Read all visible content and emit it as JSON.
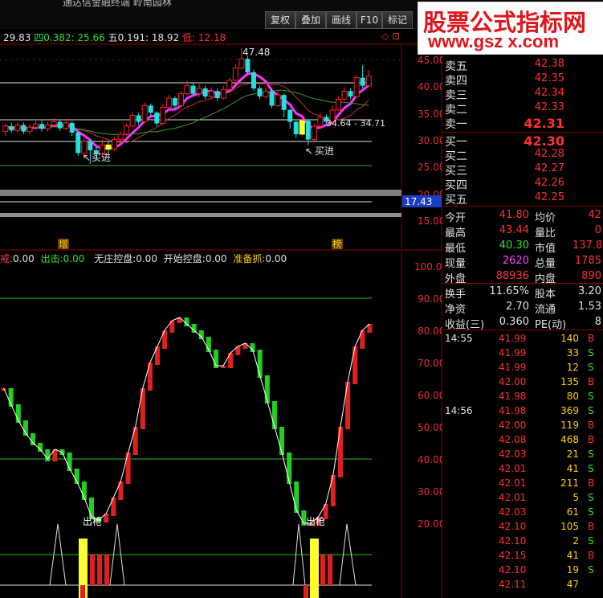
{
  "window": {
    "title": "通达信金融终端   岭南园林"
  },
  "toolbar": {
    "buttons": [
      "复权",
      "叠加",
      "画线",
      "F10",
      "标记"
    ]
  },
  "watermark": {
    "title": "股票公式指标网",
    "url": "www.gsz x.com"
  },
  "price_chart": {
    "ma_line": {
      "v1": "29.83",
      "v2_label": "四0.382:",
      "v2": "25.66",
      "v3_label": "五0.191:",
      "v3": "18.92",
      "low_label": "低:",
      "low": "12.18"
    },
    "annotations": {
      "high": "47.48",
      "range": "34.64 - 34.71",
      "buy1": "买进",
      "buy2": "买进",
      "arrow": "↖"
    },
    "y_axis": [
      "45.00",
      "40.00",
      "35.00",
      "30.00",
      "25.00",
      "20.00",
      "15.00"
    ],
    "current_tag": "17.43",
    "candles": [
      {
        "o": 32.0,
        "c": 33.0,
        "h": 33.5,
        "l": 31.2
      },
      {
        "o": 33.0,
        "c": 32.2,
        "h": 33.6,
        "l": 31.8
      },
      {
        "o": 32.2,
        "c": 33.2,
        "h": 33.8,
        "l": 31.9
      },
      {
        "o": 33.2,
        "c": 32.0,
        "h": 33.7,
        "l": 31.5
      },
      {
        "o": 32.0,
        "c": 32.8,
        "h": 33.4,
        "l": 31.6
      },
      {
        "o": 32.8,
        "c": 33.4,
        "h": 34.0,
        "l": 32.4
      },
      {
        "o": 33.4,
        "c": 32.5,
        "h": 34.0,
        "l": 32.0
      },
      {
        "o": 32.5,
        "c": 33.2,
        "h": 33.8,
        "l": 32.0
      },
      {
        "o": 33.2,
        "c": 33.8,
        "h": 34.5,
        "l": 32.8
      },
      {
        "o": 33.8,
        "c": 32.6,
        "h": 34.2,
        "l": 32.1
      },
      {
        "o": 32.6,
        "c": 33.6,
        "h": 34.2,
        "l": 32.2
      },
      {
        "o": 33.6,
        "c": 31.8,
        "h": 33.9,
        "l": 31.2
      },
      {
        "o": 31.8,
        "c": 28.0,
        "h": 32.0,
        "l": 27.5
      },
      {
        "o": 28.0,
        "c": 30.2,
        "h": 30.8,
        "l": 27.0
      },
      {
        "o": 30.2,
        "c": 28.5,
        "h": 30.5,
        "l": 26.0
      },
      {
        "o": 28.5,
        "c": 27.8,
        "h": 29.0,
        "l": 26.5
      },
      {
        "o": 27.8,
        "c": 29.5,
        "h": 30.5,
        "l": 27.2
      },
      {
        "o": 29.5,
        "c": 28.7,
        "h": 30.2,
        "l": 28.0
      },
      {
        "o": 28.7,
        "c": 30.5,
        "h": 31.0,
        "l": 28.4
      },
      {
        "o": 30.5,
        "c": 31.5,
        "h": 32.0,
        "l": 30.0
      },
      {
        "o": 31.5,
        "c": 33.0,
        "h": 33.5,
        "l": 31.2
      },
      {
        "o": 33.0,
        "c": 35.0,
        "h": 35.6,
        "l": 32.8
      },
      {
        "o": 35.0,
        "c": 33.8,
        "h": 35.5,
        "l": 33.3
      },
      {
        "o": 33.8,
        "c": 36.8,
        "h": 37.4,
        "l": 33.5
      },
      {
        "o": 36.8,
        "c": 35.5,
        "h": 37.2,
        "l": 35.0
      },
      {
        "o": 35.5,
        "c": 33.5,
        "h": 35.8,
        "l": 33.0
      },
      {
        "o": 33.5,
        "c": 36.5,
        "h": 37.0,
        "l": 33.2
      },
      {
        "o": 36.5,
        "c": 38.2,
        "h": 38.8,
        "l": 36.2
      },
      {
        "o": 38.2,
        "c": 36.8,
        "h": 38.5,
        "l": 36.3
      },
      {
        "o": 36.8,
        "c": 39.0,
        "h": 39.5,
        "l": 36.5
      },
      {
        "o": 39.0,
        "c": 40.5,
        "h": 41.5,
        "l": 38.7
      },
      {
        "o": 40.5,
        "c": 39.0,
        "h": 41.0,
        "l": 38.5
      },
      {
        "o": 39.0,
        "c": 40.0,
        "h": 40.8,
        "l": 38.4
      },
      {
        "o": 40.0,
        "c": 38.5,
        "h": 40.5,
        "l": 38.0
      },
      {
        "o": 38.5,
        "c": 39.5,
        "h": 40.2,
        "l": 38.0
      },
      {
        "o": 39.5,
        "c": 38.2,
        "h": 40.0,
        "l": 37.8
      },
      {
        "o": 38.2,
        "c": 39.8,
        "h": 40.5,
        "l": 37.9
      },
      {
        "o": 39.8,
        "c": 41.5,
        "h": 42.0,
        "l": 39.5
      },
      {
        "o": 41.5,
        "c": 43.8,
        "h": 44.5,
        "l": 41.2
      },
      {
        "o": 43.8,
        "c": 45.5,
        "h": 47.48,
        "l": 43.5
      },
      {
        "o": 45.5,
        "c": 43.0,
        "h": 46.0,
        "l": 42.5
      },
      {
        "o": 43.0,
        "c": 40.0,
        "h": 43.5,
        "l": 39.5
      },
      {
        "o": 40.0,
        "c": 38.5,
        "h": 40.5,
        "l": 38.0
      },
      {
        "o": 38.5,
        "c": 39.5,
        "h": 40.2,
        "l": 38.0
      },
      {
        "o": 39.5,
        "c": 36.8,
        "h": 40.0,
        "l": 36.3
      },
      {
        "o": 36.8,
        "c": 38.8,
        "h": 39.5,
        "l": 36.5
      },
      {
        "o": 38.8,
        "c": 36.0,
        "h": 39.0,
        "l": 34.64
      },
      {
        "o": 36.0,
        "c": 33.8,
        "h": 36.3,
        "l": 32.5
      },
      {
        "o": 33.8,
        "c": 31.5,
        "h": 34.0,
        "l": 30.8
      },
      {
        "o": 31.5,
        "c": 34.0,
        "h": 34.5,
        "l": 31.0
      },
      {
        "o": 34.0,
        "c": 30.5,
        "h": 34.2,
        "l": 29.5
      },
      {
        "o": 30.5,
        "c": 33.0,
        "h": 33.5,
        "l": 30.2
      },
      {
        "o": 33.0,
        "c": 34.71,
        "h": 35.5,
        "l": 32.5
      },
      {
        "o": 34.71,
        "c": 33.8,
        "h": 35.2,
        "l": 33.3
      },
      {
        "o": 33.8,
        "c": 36.0,
        "h": 36.8,
        "l": 33.5
      },
      {
        "o": 36.0,
        "c": 38.0,
        "h": 38.5,
        "l": 35.8
      },
      {
        "o": 38.0,
        "c": 39.5,
        "h": 40.2,
        "l": 37.7
      },
      {
        "o": 39.5,
        "c": 38.5,
        "h": 40.0,
        "l": 38.0
      },
      {
        "o": 38.5,
        "c": 42.0,
        "h": 42.5,
        "l": 38.3
      },
      {
        "o": 42.0,
        "c": 40.5,
        "h": 44.3,
        "l": 40.0
      },
      {
        "o": 40.5,
        "c": 42.3,
        "h": 43.4,
        "l": 40.3
      }
    ]
  },
  "volume_strip": {
    "left_label": "增",
    "right_label": "榜"
  },
  "indicator": {
    "legend": [
      {
        "label": "戒:",
        "value": "0.00"
      },
      {
        "label": "出击:",
        "value": "0.00"
      },
      {
        "label": "无庄控盘:",
        "value": "0.00"
      },
      {
        "label": "开始控盘:",
        "value": "0.00"
      },
      {
        "label": "准备抓:",
        "value": "0.00"
      }
    ],
    "y_axis": [
      "100.00",
      "90.00",
      "80.00",
      "70.00",
      "60.00",
      "50.00",
      "40.00",
      "30.00",
      "20.00"
    ],
    "labels": {
      "chu1": "出枪",
      "chu2": "出枪"
    },
    "bars": [
      62,
      57,
      52,
      48,
      45,
      43,
      40,
      43,
      42,
      37,
      33,
      28,
      22,
      21,
      23,
      28,
      33,
      42,
      50,
      62,
      70,
      75,
      80,
      83,
      84,
      82,
      80,
      78,
      74,
      69,
      69,
      73,
      75,
      76,
      74,
      66,
      58,
      50,
      42,
      33,
      24,
      20,
      20,
      22,
      26,
      35,
      50,
      64,
      75,
      80,
      82
    ]
  },
  "quote": {
    "sells": [
      {
        "label": "卖五",
        "price": "42.38"
      },
      {
        "label": "卖四",
        "price": "42.35"
      },
      {
        "label": "卖三",
        "price": "42.34"
      },
      {
        "label": "卖二",
        "price": "42.33"
      },
      {
        "label": "卖一",
        "price": "42.31"
      }
    ],
    "buys": [
      {
        "label": "买一",
        "price": "42.30"
      },
      {
        "label": "买二",
        "price": "42.28"
      },
      {
        "label": "买三",
        "price": "42.27"
      },
      {
        "label": "买四",
        "price": "42.26"
      },
      {
        "label": "买五",
        "price": "42.25"
      }
    ],
    "stats": [
      {
        "l1": "今开",
        "v1": "41.80",
        "c1": "#ff3030",
        "l2": "均价",
        "v2": "42"
      },
      {
        "l1": "最高",
        "v1": "43.44",
        "c1": "#ff3030",
        "l2": "量比",
        "v2": "0"
      },
      {
        "l1": "最低",
        "v1": "40.30",
        "c1": "#30e030",
        "l2": "市值",
        "v2": "137.8"
      },
      {
        "l1": "现量",
        "v1": "2620",
        "c1": "#ff40ff",
        "l2": "总量",
        "v2": "1785"
      },
      {
        "l1": "外盘",
        "v1": "88936",
        "c1": "#ff3030",
        "l2": "内盘",
        "v2": "890"
      }
    ],
    "stats2": [
      {
        "l1": "换手",
        "v1": "11.65%",
        "l2": "股本",
        "v2": "3.20"
      },
      {
        "l1": "净资",
        "v1": "2.70",
        "l2": "流通",
        "v2": "1.53"
      },
      {
        "l1": "收益(三)",
        "v1": "0.360",
        "l2": "PE(动)",
        "v2": "8"
      }
    ],
    "ticks_header1": "14:55",
    "ticks_header2": "14:56",
    "ticks": [
      {
        "p": "41.99",
        "v": "140",
        "s": "B"
      },
      {
        "p": "41.99",
        "v": "33",
        "s": "S"
      },
      {
        "p": "41.99",
        "v": "12",
        "s": "S"
      },
      {
        "p": "42.00",
        "v": "135",
        "s": "B"
      },
      {
        "p": "41.98",
        "v": "80",
        "s": "S"
      },
      {
        "p": "41.98",
        "v": "369",
        "s": "S"
      },
      {
        "p": "42.00",
        "v": "119",
        "s": "B"
      },
      {
        "p": "42.08",
        "v": "468",
        "s": "B"
      },
      {
        "p": "42.03",
        "v": "21",
        "s": "S"
      },
      {
        "p": "42.01",
        "v": "41",
        "s": "S"
      },
      {
        "p": "42.01",
        "v": "211",
        "s": "B"
      },
      {
        "p": "42.01",
        "v": "5",
        "s": "S"
      },
      {
        "p": "42.03",
        "v": "61",
        "s": "S"
      },
      {
        "p": "42.10",
        "v": "105",
        "s": "B"
      },
      {
        "p": "42.10",
        "v": "2",
        "s": "S"
      },
      {
        "p": "42.15",
        "v": "41",
        "s": "B"
      },
      {
        "p": "42.10",
        "v": "19",
        "s": "S"
      },
      {
        "p": "42.11",
        "v": "47",
        "s": ""
      }
    ]
  },
  "colors": {
    "up": "#ff2020",
    "down": "#20e0e0",
    "ma": "#ff30ff",
    "grid": "#800000",
    "green": "#20c020"
  }
}
